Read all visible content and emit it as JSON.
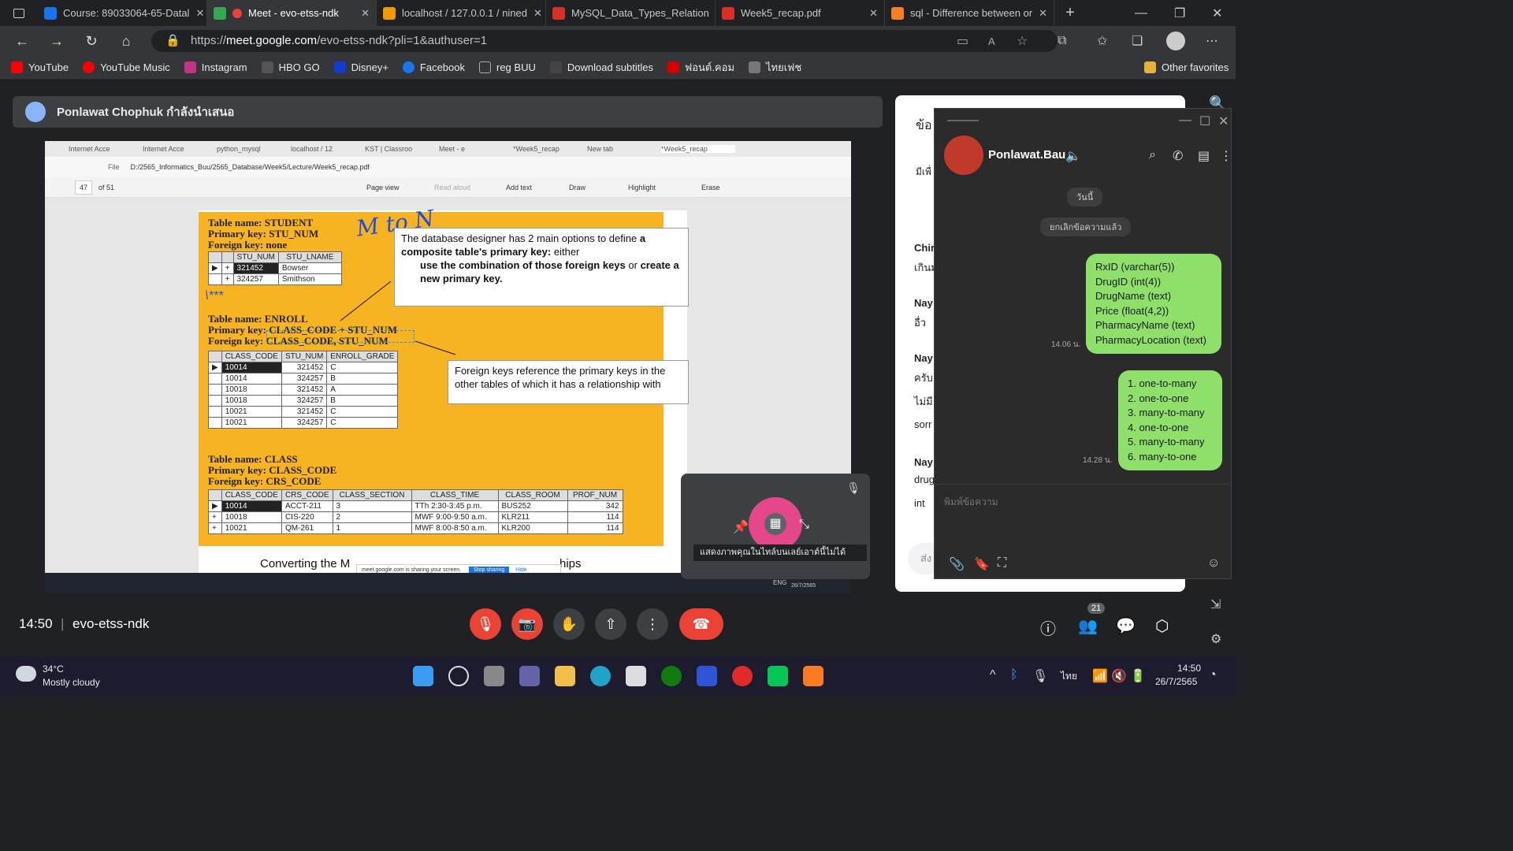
{
  "tabs": [
    {
      "label": "Course: 89033064-65-Datal",
      "color": "#1a73e8"
    },
    {
      "label": "Meet - evo-etss-ndk",
      "color": "#ea4335",
      "active": true
    },
    {
      "label": "localhost / 127.0.0.1 / nined",
      "color": "#f29900"
    },
    {
      "label": "MySQL_Data_Types_Relation",
      "color": "#d93025"
    },
    {
      "label": "Week5_recap.pdf",
      "color": "#d93025"
    },
    {
      "label": "sql - Difference between or",
      "color": "#f48024"
    }
  ],
  "address": {
    "protocol": "https://",
    "host": "meet.google.com",
    "path": "/evo-etss-ndk?pli=1&authuser=1"
  },
  "bookmarks": [
    {
      "label": "YouTube",
      "color": "#ff0000"
    },
    {
      "label": "YouTube Music",
      "color": "#ff0000"
    },
    {
      "label": "Instagram",
      "color": "#c13584"
    },
    {
      "label": "HBO GO",
      "color": "#555555"
    },
    {
      "label": "Disney+",
      "color": "#113ccf"
    },
    {
      "label": "Facebook",
      "color": "#1877f2"
    },
    {
      "label": "reg BUU",
      "color": "#aaaaaa"
    },
    {
      "label": "Download subtitles",
      "color": "#444444"
    },
    {
      "label": "ฟอนต์.คอม",
      "color": "#d50000"
    },
    {
      "label": "ไทยเฟช",
      "color": "#777777"
    }
  ],
  "other_favorites": "Other favorites",
  "presenter": {
    "text": "Ponlawat Chophuk กำลังนำเสนอ"
  },
  "shared": {
    "mini_tabs": [
      "Internet Acce",
      "Internet Acce",
      "python_mysql",
      "localhost / 12",
      "KST | Classroo",
      "Meet - e",
      "*Week5_recap",
      "New tab",
      "*Week5_recap"
    ],
    "file_path": "D:/2565_Informatics_Buu/2565_Database/Week5/Lecture/Week5_recap.pdf",
    "file_label": "File",
    "page_num": "47",
    "page_total": "of 51",
    "toolbar": [
      "Page view",
      "Read aloud",
      "Add text",
      "Draw",
      "Highlight",
      "Erase"
    ],
    "student": {
      "l1": "Table name: STUDENT",
      "l2": "Primary key: STU_NUM",
      "l3": "Foreign key: none",
      "headers": [
        "STU_NUM",
        "STU_LNAME"
      ],
      "rows": [
        [
          "321452",
          "Bowser"
        ],
        [
          "324257",
          "Smithson"
        ]
      ]
    },
    "enroll": {
      "l1": "Table name: ENROLL",
      "l2": "Primary key: CLASS_CODE + STU_NUM",
      "l3": "Foreign key: CLASS_CODE, STU_NUM",
      "headers": [
        "CLASS_CODE",
        "STU_NUM",
        "ENROLL_GRADE"
      ],
      "rows": [
        [
          "10014",
          "321452",
          "C"
        ],
        [
          "10014",
          "324257",
          "B"
        ],
        [
          "10018",
          "321452",
          "A"
        ],
        [
          "10018",
          "324257",
          "B"
        ],
        [
          "10021",
          "321452",
          "C"
        ],
        [
          "10021",
          "324257",
          "C"
        ]
      ]
    },
    "class": {
      "l1": "Table name: CLASS",
      "l2": "Primary key: CLASS_CODE",
      "l3": "Foreign key: CRS_CODE",
      "headers": [
        "CLASS_CODE",
        "CRS_CODE",
        "CLASS_SECTION",
        "CLASS_TIME",
        "CLASS_ROOM",
        "PROF_NUM"
      ],
      "rows": [
        [
          "10014",
          "ACCT-211",
          "3",
          "TTh 2:30-3:45 p.m.",
          "BUS252",
          "342"
        ],
        [
          "10018",
          "CIS-220",
          "2",
          "MWF 9:00-9:50 a.m.",
          "KLR211",
          "114"
        ],
        [
          "10021",
          "QM-261",
          "1",
          "MWF 8:00-8:50 a.m.",
          "KLR200",
          "114"
        ]
      ]
    },
    "callout1_a": "The database designer has 2 main options to define",
    "callout1_b": "a composite table's primary key:",
    "callout1_c": "either",
    "callout1_d": "use the combination of those foreign keys",
    "callout1_e": "or",
    "callout1_f": "create a new primary key.",
    "callout2": "Foreign keys reference the primary keys in the other tables of which it has a relationship with",
    "handwriting": "M to N",
    "stars": "\\***",
    "footer_left": "Converting the M",
    "footer_right": "hips",
    "sharing_note": "meet.google.com is sharing your screen.",
    "stop_sharing": "Stop sharing",
    "hide": "Hide",
    "mini_tray_lang": "ENG",
    "mini_tray_date": "26/7/2565"
  },
  "self_tile": {
    "caption": "แสดงภาพคุณในไทล์บนเลย์เอาต์นี้ไม่ได้"
  },
  "side_panel": {
    "title_stub": "ข้อ",
    "stubs": [
      "มีเพื่",
      "Chir",
      "เกินม",
      "Nay",
      "อื่ว",
      "Nay",
      "ครับ",
      "ไม่มี",
      "sorr",
      "Nay",
      "drug",
      "int",
      "ส่ง"
    ]
  },
  "line_chat": {
    "contact": "Ponlawat.Bau",
    "day_label": "วันนี้",
    "unsent_label": "ยกเลิกข้อความแล้ว",
    "msg1": [
      "RxID (varchar(5))",
      "DrugID (int(4))",
      "DrugName (text)",
      "Price (float(4,2))",
      "PharmacyName (text)",
      "PharmacyLocation (text)"
    ],
    "msg1_time": "14.06 น.",
    "msg2": [
      "1. one-to-many",
      "2. one-to-one",
      "3. many-to-many",
      "4. one-to-one",
      "5. many-to-many",
      "6. many-to-one"
    ],
    "msg2_time": "14.28 น.",
    "input_placeholder": "พิมพ์ข้อความ"
  },
  "meet_bar": {
    "time": "14:50",
    "separator": "|",
    "code": "evo-etss-ndk",
    "people_count": "21"
  },
  "taskbar": {
    "temp": "34°C",
    "weather": "Mostly cloudy",
    "lang": "ไทย",
    "clock": "14:50",
    "date": "26/7/2565"
  }
}
